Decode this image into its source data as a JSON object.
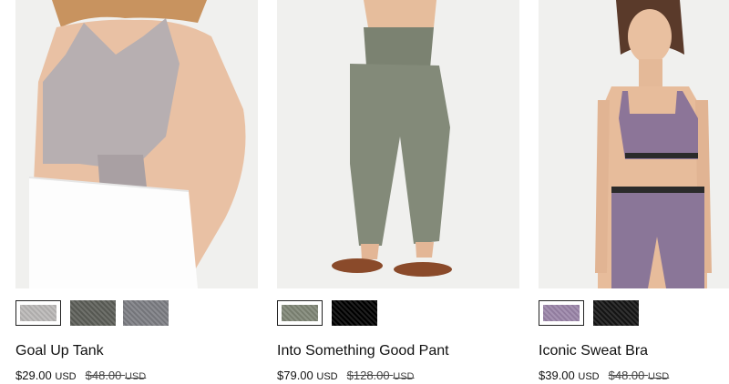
{
  "products": [
    {
      "name": "Goal Up Tank",
      "sale_price": "$29.00",
      "sale_unit": "USD",
      "original_price": "$48.00",
      "original_unit": "USD",
      "image_icon": "tank-top-photo",
      "swatches": [
        {
          "color": "#b9b7b6",
          "selected": true
        },
        {
          "color": "#5b5d57",
          "selected": false
        },
        {
          "color": "#7b7c82",
          "selected": false
        }
      ]
    },
    {
      "name": "Into Something Good Pant",
      "sale_price": "$79.00",
      "sale_unit": "USD",
      "original_price": "$128.00",
      "original_unit": "USD",
      "image_icon": "pants-photo",
      "swatches": [
        {
          "color": "#7e8575",
          "selected": true
        },
        {
          "color": "#000000",
          "selected": false
        }
      ]
    },
    {
      "name": "Iconic Sweat Bra",
      "sale_price": "$39.00",
      "sale_unit": "USD",
      "original_price": "$48.00",
      "original_unit": "USD",
      "image_icon": "sports-bra-photo",
      "swatches": [
        {
          "color": "#9a84a8",
          "selected": true
        },
        {
          "color": "#151515",
          "selected": false
        }
      ]
    }
  ]
}
